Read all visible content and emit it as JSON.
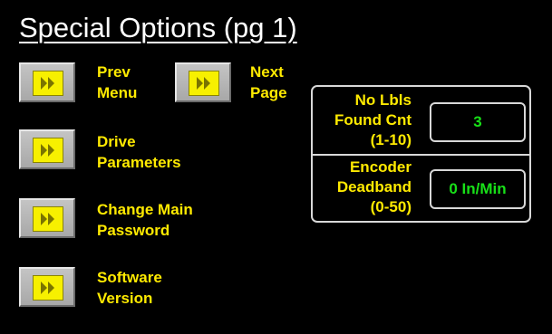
{
  "title": "Special Options (pg 1)",
  "buttons": {
    "prev_menu": {
      "line1": "Prev",
      "line2": "Menu"
    },
    "next_page": {
      "line1": "Next",
      "line2": "Page"
    },
    "drive_parameters": {
      "line1": "Drive",
      "line2": "Parameters"
    },
    "change_password": {
      "line1": "Change Main",
      "line2": "Password"
    },
    "software_version": {
      "line1": "Software",
      "line2": "Version"
    },
    "icon": "fast-forward-icon"
  },
  "settings": {
    "no_labels": {
      "line1": "No Lbls",
      "line2": "Found Cnt",
      "line3": "(1-10)",
      "value": "3"
    },
    "encoder": {
      "line1": "Encoder",
      "line2": "Deadband",
      "line3": "(0-50)",
      "value": "0 In/Min"
    }
  },
  "colors": {
    "background": "#000000",
    "label": "#ffea00",
    "value": "#18e018",
    "button": "#b8b8b8",
    "arrow_box": "#f7f000"
  }
}
